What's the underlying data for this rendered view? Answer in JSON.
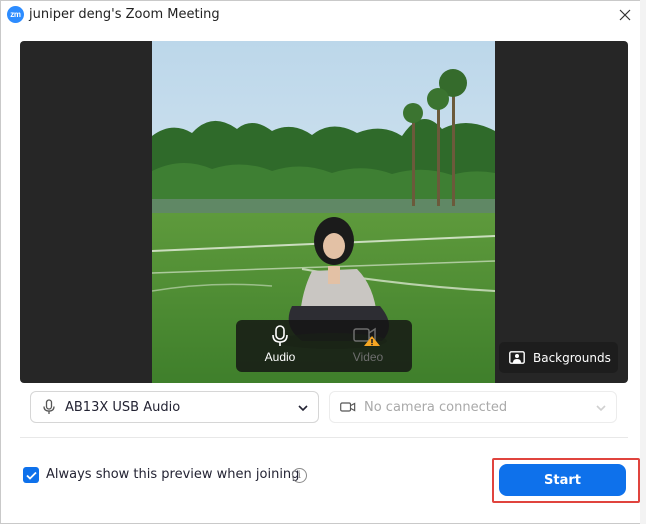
{
  "window": {
    "app_logo_text": "zm",
    "title": "juniper deng's Zoom Meeting",
    "close_icon": "close-icon"
  },
  "preview": {
    "audio_label": "Audio",
    "video_label": "Video",
    "audio_icon": "microphone-icon",
    "video_icon": "camera-icon",
    "video_warning_icon": "warning-icon",
    "backgrounds_label": "Backgrounds",
    "backgrounds_icon": "person-frame-icon"
  },
  "devices": {
    "audio_device": "AB13X USB Audio",
    "video_device": "No camera connected"
  },
  "footer": {
    "always_show_checked": true,
    "always_show_label": "Always show this preview when joining",
    "info_icon_glyph": "i",
    "start_label": "Start"
  },
  "colors": {
    "accent": "#0E71EB",
    "logo": "#2D8CFF",
    "highlight": "#e0443e",
    "warning": "#F5A623"
  }
}
